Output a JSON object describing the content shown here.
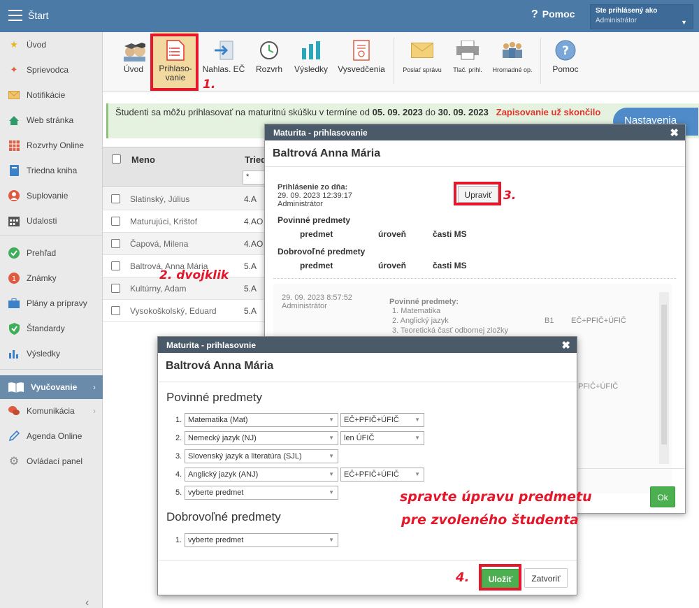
{
  "topbar": {
    "title": "Štart",
    "help_label": "Pomoc",
    "user_label": "Ste prihlásený ako",
    "user_name": "Administrátor"
  },
  "sidebar": {
    "items": [
      {
        "label": "Úvod",
        "icon": "star-icon"
      },
      {
        "label": "Sprievodca",
        "icon": "wand-icon"
      },
      {
        "label": "Notifikácie",
        "icon": "envelope-icon"
      },
      {
        "label": "Web stránka",
        "icon": "house-icon"
      },
      {
        "label": "Rozvrhy Online",
        "icon": "grid-icon"
      },
      {
        "label": "Triedna kniha",
        "icon": "book-icon"
      },
      {
        "label": "Suplovanie",
        "icon": "person-icon"
      },
      {
        "label": "Udalosti",
        "icon": "calendar-icon"
      },
      {
        "label": "Prehľad",
        "icon": "check-circle-icon"
      },
      {
        "label": "Známky",
        "icon": "grade-icon"
      },
      {
        "label": "Plány a prípravy",
        "icon": "briefcase-icon"
      },
      {
        "label": "Štandardy",
        "icon": "shield-check-icon"
      },
      {
        "label": "Výsledky",
        "icon": "bar-chart-icon"
      },
      {
        "label": "Vyučovanie",
        "icon": "open-book-icon"
      },
      {
        "label": "Komunikácia",
        "icon": "chat-icon"
      },
      {
        "label": "Agenda Online",
        "icon": "pen-icon"
      },
      {
        "label": "Ovládací panel",
        "icon": "gear-icon"
      }
    ]
  },
  "toolbar": {
    "uvod": "Úvod",
    "prihlasovanie_1": "Prihlaso-",
    "prihlasovanie_2": "vanie",
    "nahlas": "Nahlas. EČ",
    "rozvrh": "Rozvrh",
    "vysledky": "Výsledky",
    "vysvedcenia": "Vysvedčenia",
    "poslat": "Poslať správu",
    "tlac": "Tlač. prihl.",
    "hromadne": "Hromadné op.",
    "pomoc": "Pomoc"
  },
  "banner": {
    "text_pre": "Študenti sa môžu prihlasovať na maturitnú skúšku v termíne od ",
    "date_from": "05. 09. 2023",
    "text_mid": " do ",
    "date_to": "30. 09. 2023",
    "closed": "Zapisovanie už skončilo",
    "settings_button": "Nastavenia"
  },
  "table": {
    "col_name": "Meno",
    "col_class": "Trieda",
    "filter_value": "*",
    "rows": [
      {
        "name": "Slatinský, Július",
        "cls": "4.A"
      },
      {
        "name": "Maturujúci, Krištof",
        "cls": "4.AO"
      },
      {
        "name": "Čapová, Milena",
        "cls": "4.AO"
      },
      {
        "name": "Baltrová, Anna Mária",
        "cls": "5.A"
      },
      {
        "name": "Kultúrny, Adam",
        "cls": "5.A"
      },
      {
        "name": "Vysokoškolský, Eduard",
        "cls": "5.A"
      }
    ]
  },
  "dialog1": {
    "header": "Maturita - prihlasovanie",
    "student": "Baltrová Anna Mária",
    "entry_label": "Prihlásenie zo dňa:",
    "entry_date": "29. 09. 2023 12:39:17",
    "entry_user": "Administrátor",
    "edit_button": "Upraviť",
    "mandatory_title": "Povinné predmety",
    "optional_title": "Dobrovoľné predmety",
    "col_subject": "predmet",
    "col_level": "úroveň",
    "col_parts": "časti MS",
    "history": {
      "date": "29. 09. 2023 8:57:52",
      "user": "Administrátor",
      "title": "Povinné predmety:",
      "items": [
        {
          "label": "1. Matematika",
          "level": "",
          "parts": ""
        },
        {
          "label": "2. Anglický jazyk",
          "level": "B1",
          "parts": "EČ+PFIČ+ÚFIČ"
        },
        {
          "label": "3. Teoretická časť odbornej zložky",
          "level": "",
          "parts": ""
        }
      ],
      "partial_text": "PFIČ+ÚFIČ"
    },
    "ok_button": "Ok"
  },
  "dialog2": {
    "header": "Maturita - prihlasovnie",
    "student": "Baltrová Anna Mária",
    "mandatory_title": "Povinné predmety",
    "optional_title": "Dobrovoľné predmety",
    "mandatory": [
      {
        "num": "1.",
        "subject": "Matematika (Mat)",
        "parts": "EČ+PFIČ+ÚFIČ"
      },
      {
        "num": "2.",
        "subject": "Nemecký jazyk (NJ)",
        "parts": "len ÚFIČ"
      },
      {
        "num": "3.",
        "subject": "Slovenský jazyk a literatúra (SJL)",
        "parts": ""
      },
      {
        "num": "4.",
        "subject": "Anglický jazyk (ANJ)",
        "parts": "EČ+PFIČ+ÚFIČ"
      },
      {
        "num": "5.",
        "subject": "vyberte predmet",
        "parts": ""
      }
    ],
    "optional": [
      {
        "num": "1.",
        "subject": "vyberte predmet"
      }
    ],
    "save_button": "Uložiť",
    "close_button": "Zatvoriť"
  },
  "annotations": {
    "step1": "1.",
    "step2": "2. dvojklik",
    "step3": "3.",
    "step4": "4.",
    "note_line1": "spravte úpravu predmetu",
    "note_line2": "pre zvoleného študenta"
  },
  "colors": {
    "topbar": "#4b7aa6",
    "highlight": "#e5172a",
    "ok_green": "#4caf50",
    "dialog_header": "#4a5a68"
  }
}
